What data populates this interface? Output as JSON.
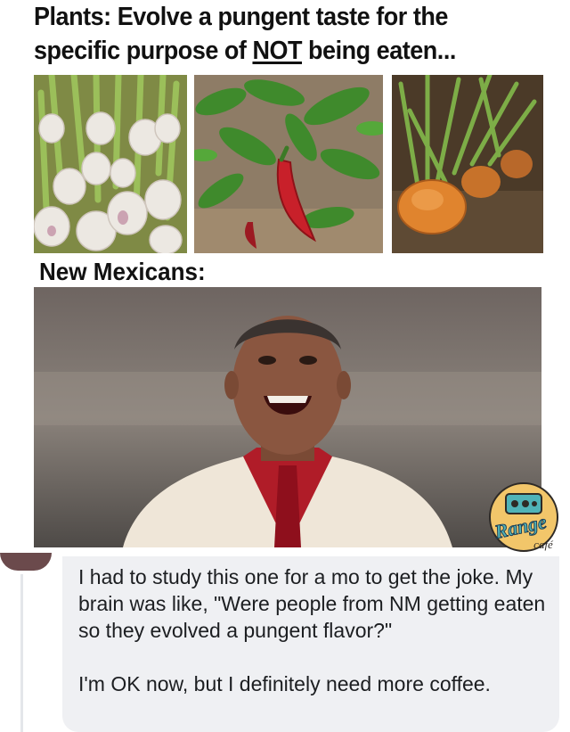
{
  "meme": {
    "headline_line1": "Plants: Evolve a pungent taste for the",
    "headline_line2_start": "specific purpose of ",
    "headline_emphasis": "NOT",
    "headline_line2_end": " being eaten...",
    "subhead": "New Mexicans:",
    "images": {
      "garlic": "garlic-bulbs-photo",
      "pepper": "red-chile-pepper-plant-photo",
      "onion": "onion-in-soil-photo",
      "laugh": "laughing-man-photo"
    }
  },
  "watermark": {
    "brand": "Range",
    "sub": "café"
  },
  "comment": {
    "text_line1": "I had to study this one for a mo to get the joke. My brain was like, \"Were people from NM getting eaten so they evolved a pungent flavor?\"",
    "text_line2": "I'm OK now, but I definitely need more coffee."
  },
  "colors": {
    "headline": "#111111",
    "bubble_bg": "#eff0f3",
    "comment_text": "#1c1e21",
    "chile_red": "#c8202a",
    "shirt_red": "#b01c28",
    "suit_cream": "#efe6d8"
  }
}
